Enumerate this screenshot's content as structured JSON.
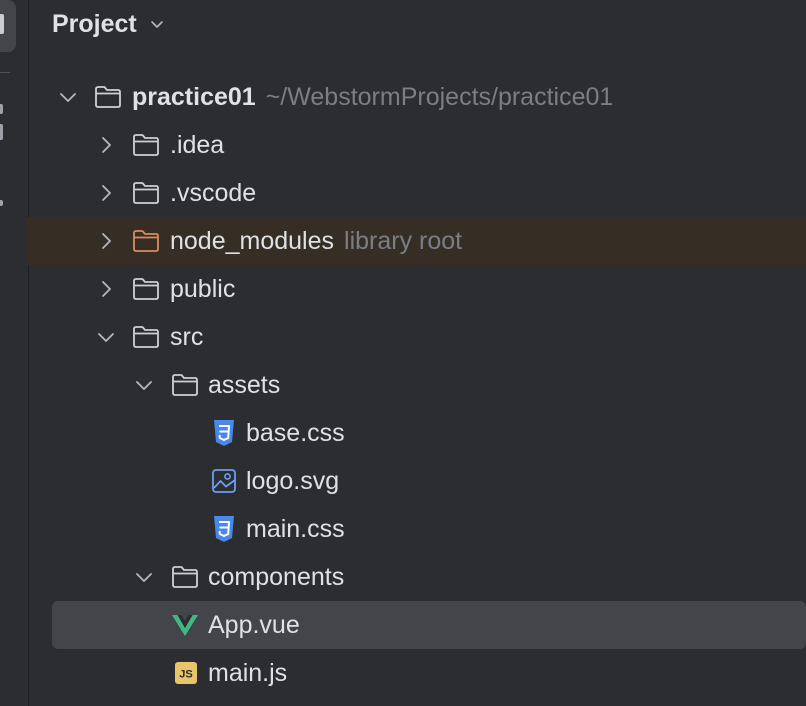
{
  "panel": {
    "title": "Project"
  },
  "tree": {
    "root": {
      "name": "practice01",
      "path": "~/WebstormProjects/practice01"
    },
    "idea": {
      "name": ".idea"
    },
    "vscode": {
      "name": ".vscode"
    },
    "node_modules": {
      "name": "node_modules",
      "hint": "library root"
    },
    "public": {
      "name": "public"
    },
    "src": {
      "name": "src"
    },
    "assets": {
      "name": "assets"
    },
    "base_css": {
      "name": "base.css"
    },
    "logo_svg": {
      "name": "logo.svg"
    },
    "main_css": {
      "name": "main.css"
    },
    "components": {
      "name": "components"
    },
    "app_vue": {
      "name": "App.vue"
    },
    "main_js": {
      "name": "main.js"
    }
  },
  "icons": {
    "folder": "folder-icon",
    "library_folder": "library-folder-icon",
    "css": "css-file-icon",
    "image": "image-file-icon",
    "vue": "vue-file-icon",
    "js": "js-file-icon"
  },
  "colors": {
    "background": "#2b2d30",
    "library_row": "#362d24",
    "selected_row": "#43454a",
    "css_icon": "#4a87e8",
    "vue_icon": "#41b883",
    "js_icon": "#e8c46a",
    "library_folder": "#d98b5f"
  }
}
